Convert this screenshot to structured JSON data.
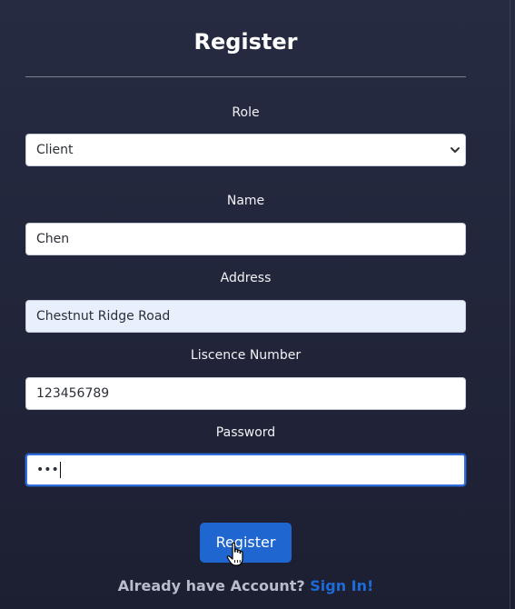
{
  "form": {
    "title": "Register",
    "role": {
      "label": "Role",
      "selected": "Client"
    },
    "name": {
      "label": "Name",
      "value": "Chen"
    },
    "address": {
      "label": "Address",
      "value": "Chestnut Ridge Road"
    },
    "licence": {
      "label": "Liscence Number",
      "value": "123456789"
    },
    "password": {
      "label": "Password",
      "masked_value": "•••"
    },
    "submit_label": "Register"
  },
  "footer": {
    "prompt": "Already have Account?",
    "link_label": "Sign In!"
  },
  "icons": {
    "select_arrow": "chevron-down-icon",
    "cursor": "hand-pointer-icon"
  },
  "colors": {
    "background": "#262b42",
    "button": "#1f66d1",
    "link": "#1d6bd6",
    "autofill": "#e8f0fe"
  }
}
